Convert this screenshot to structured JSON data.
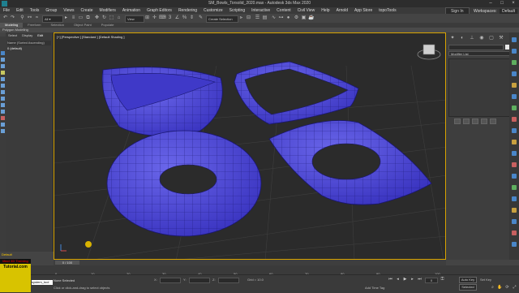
{
  "window": {
    "title": "SM_Bowls_Torsolid_2020.max - Autodesk 3ds Max 2020"
  },
  "menubar": {
    "items": [
      "File",
      "Edit",
      "Tools",
      "Group",
      "Views",
      "Create",
      "Modifiers",
      "Animation",
      "Graph Editors",
      "Rendering",
      "Customize",
      "Scripting",
      "Interactive",
      "Content",
      "Civil View",
      "Help",
      "Arnold",
      "App Store",
      "topoTools"
    ],
    "signin": "Sign In",
    "workspaces_label": "Workspaces:",
    "workspaces_value": "Default"
  },
  "toolbar": {
    "view_select": "View",
    "selection_sets": "Create Selection Se"
  },
  "ribbon": {
    "tabs": [
      "Modeling",
      "Freeform",
      "Selection",
      "Object Paint",
      "Populate"
    ],
    "active": "Modeling",
    "sub_label": "Polygon Modeling"
  },
  "scene_explorer": {
    "tabs": [
      "Select",
      "Display",
      "Edit"
    ],
    "header": "Name (Sorted Ascending)",
    "row": "0 (default)"
  },
  "viewport": {
    "label": "[+] [Perspective ] [Standard ] [Default Shading ]",
    "colors": {
      "mesh": "#4b45d6",
      "wire": "#1a1770",
      "frame": "#d9a400"
    }
  },
  "command_panel": {
    "modifier_list": "Modifier List"
  },
  "timeline": {
    "slider": "0 / 100",
    "ticks": [
      "0",
      "10",
      "20",
      "30",
      "40",
      "50",
      "60",
      "70",
      "80",
      "90",
      "100"
    ]
  },
  "status": {
    "layer": "Default",
    "script": "system_tool",
    "selection": "None Selected",
    "prompt": "Click or click-and-drag to select objects",
    "x_label": "X:",
    "y_label": "Y:",
    "z_label": "Z:",
    "grid": "Grid = 10.0",
    "add_time_tag": "Add Time Tag",
    "autokey": "Auto Key",
    "selected": "Selected",
    "setkey": "Set Key",
    "frame": "0"
  },
  "logo": {
    "line1": "Maxi 3D Training",
    "line2": "Tutorial.com"
  }
}
